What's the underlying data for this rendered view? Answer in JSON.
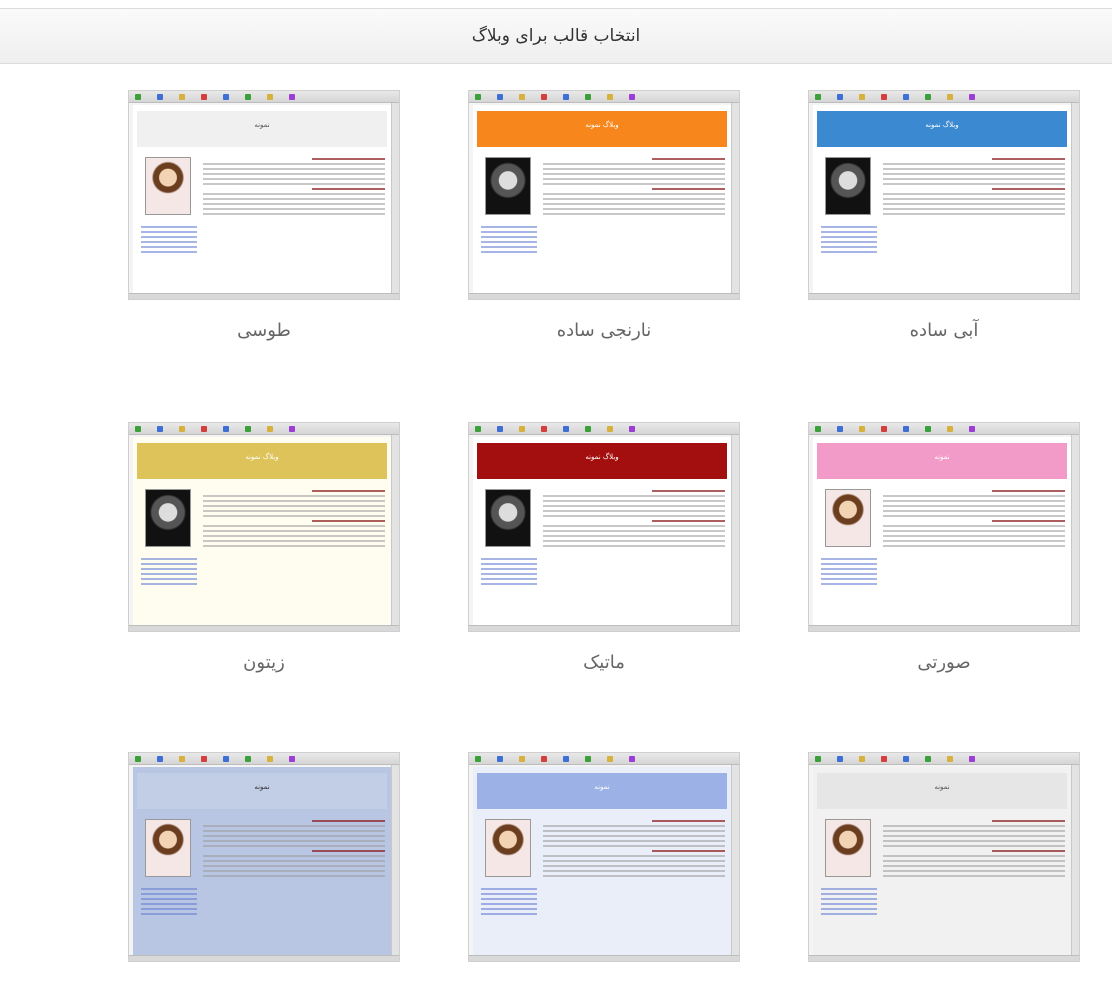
{
  "header": {
    "title": "انتخاب قالب برای وبلاگ"
  },
  "themes": [
    {
      "label": "آبی ساده",
      "banner_color": "#3a89d1",
      "banner_text": "وبلاگ نمونه",
      "photo": "einstein",
      "bg": "#ffffff"
    },
    {
      "label": "نارنجی ساده",
      "banner_color": "#f7861c",
      "banner_text": "وبلاگ نمونه",
      "photo": "einstein",
      "bg": "#ffffff"
    },
    {
      "label": "طوسی",
      "banner_color": "#f0f0f0",
      "banner_text": "نمونه",
      "photo": "child",
      "bg": "#ffffff"
    },
    {
      "label": "صورتی",
      "banner_color": "#f29bc8",
      "banner_text": "نمونه",
      "photo": "child",
      "bg": "#ffffff"
    },
    {
      "label": "ماتیک",
      "banner_color": "#a30f0f",
      "banner_text": "وبلاگ نمونه",
      "photo": "einstein",
      "bg": "#ffffff"
    },
    {
      "label": "زیتون",
      "banner_color": "#ddc35a",
      "banner_text": "وبلاگ نمونه",
      "photo": "einstein",
      "bg": "#fffdf0"
    },
    {
      "label": "",
      "banner_color": "#e6e6e6",
      "banner_text": "نمونه",
      "photo": "child",
      "bg": "#f1f1f1"
    },
    {
      "label": "",
      "banner_color": "#9cb2e6",
      "banner_text": "نمونه",
      "photo": "child",
      "bg": "#e9eef9"
    },
    {
      "label": "",
      "banner_color": "#c2cde6",
      "banner_text": "نمونه",
      "photo": "child",
      "bg": "#b8c6e3"
    }
  ]
}
